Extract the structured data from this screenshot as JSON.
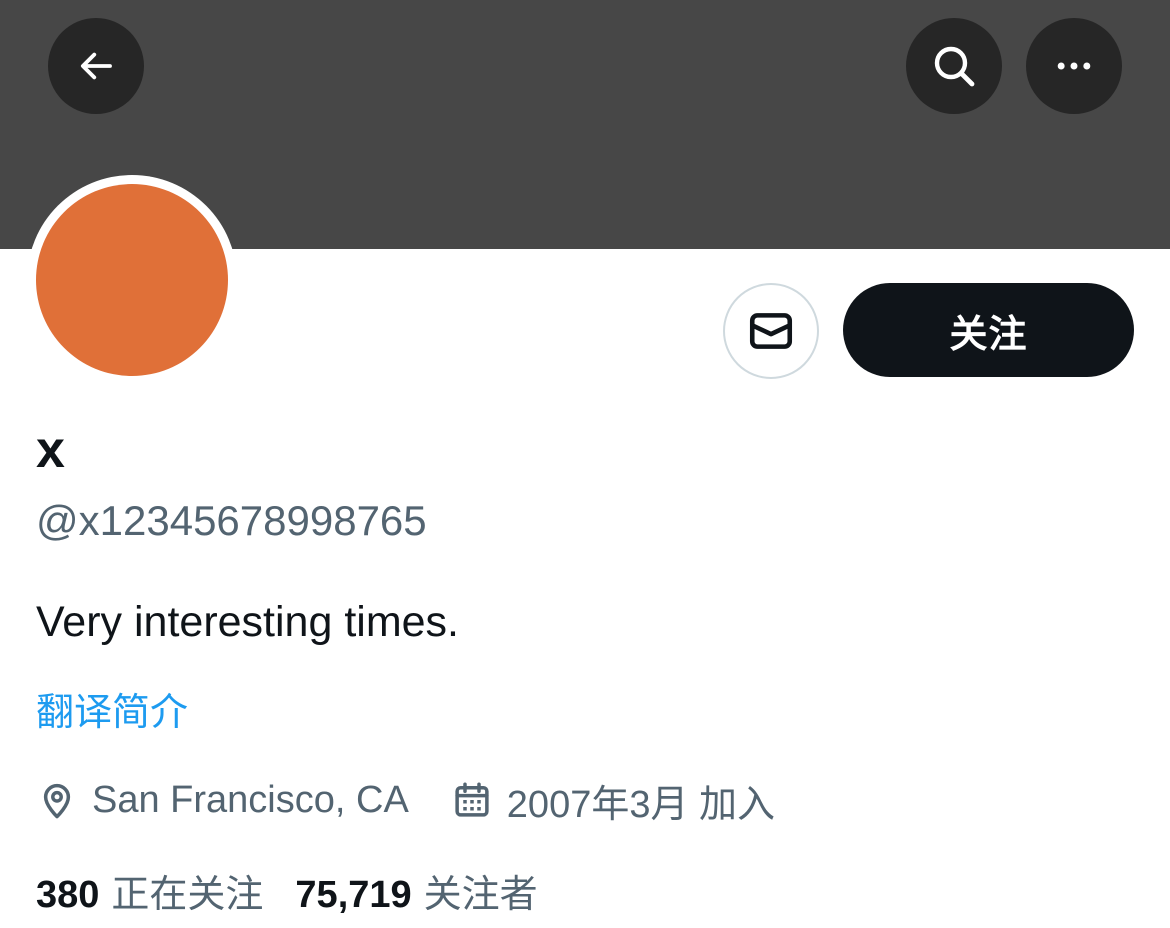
{
  "header": {
    "back_icon": "arrow-left-icon",
    "search_icon": "search-icon",
    "more_icon": "more-horizontal-icon",
    "banner_color": "#474747"
  },
  "profile": {
    "avatar_color": "#e07038",
    "display_name": "x",
    "handle": "@x12345678998765",
    "bio": "Very interesting times.",
    "translate_label": "翻译简介",
    "location": "San Francisco, CA",
    "joined": "2007年3月 加入",
    "location_icon": "map-pin-icon",
    "calendar_icon": "calendar-icon"
  },
  "actions": {
    "message_icon": "envelope-icon",
    "follow_label": "关注"
  },
  "stats": {
    "following_count": "380",
    "following_label": "正在关注",
    "followers_count": "75,719",
    "followers_label": "关注者"
  },
  "colors": {
    "accent": "#1d9bf0",
    "text_primary": "#0f1419",
    "text_secondary": "#536471",
    "button_dark": "#0f1419"
  }
}
